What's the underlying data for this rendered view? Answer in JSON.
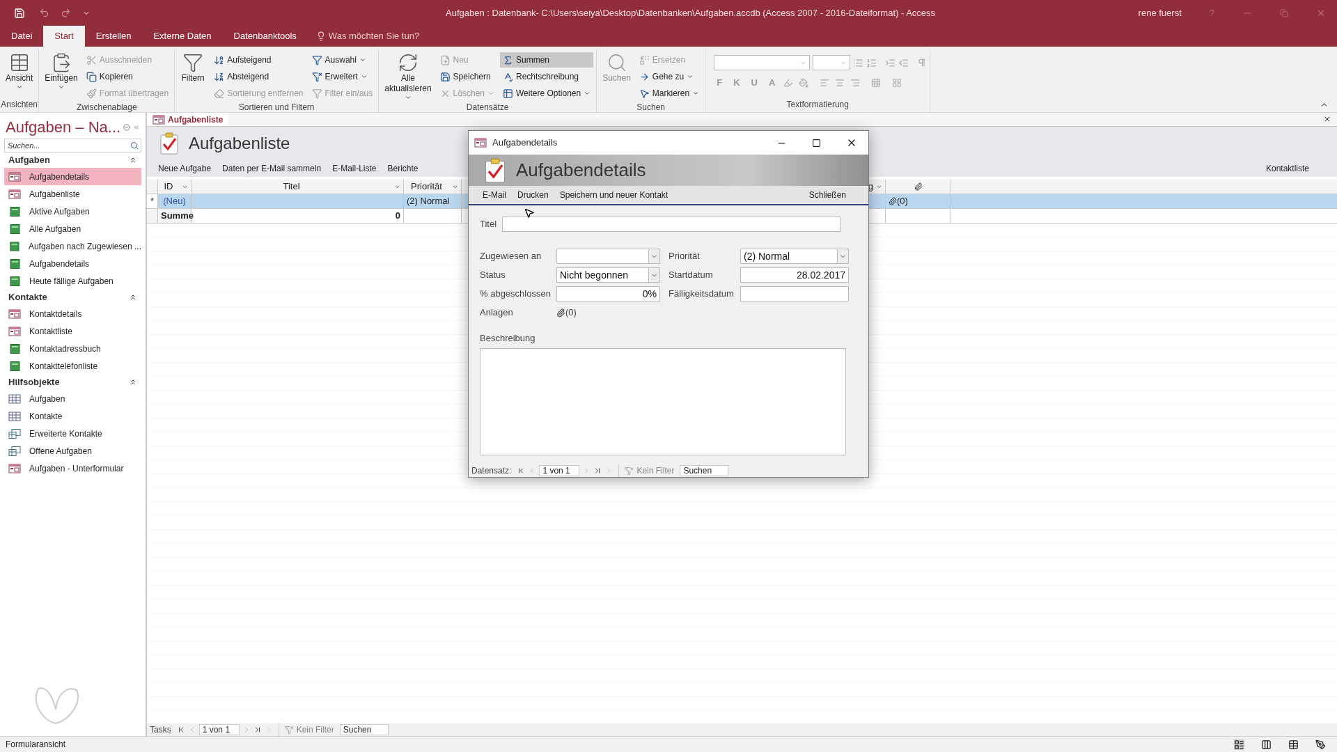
{
  "title_bar": {
    "title": "Aufgaben : Datenbank- C:\\Users\\seiya\\Desktop\\Datenbanken\\Aufgaben.accdb (Access 2007 - 2016-Dateiformat)  -  Access",
    "user": "rene fuerst",
    "help": "?"
  },
  "ribbon_tabs": [
    {
      "label": "Datei",
      "selected": false
    },
    {
      "label": "Start",
      "selected": true
    },
    {
      "label": "Erstellen",
      "selected": false
    },
    {
      "label": "Externe Daten",
      "selected": false
    },
    {
      "label": "Datenbanktools",
      "selected": false
    }
  ],
  "tell_me": "Was möchten Sie tun?",
  "ribbon_groups": [
    {
      "label": "Ansichten",
      "large": [
        {
          "label": "Ansicht",
          "dropdown": true,
          "disabled": false
        }
      ]
    },
    {
      "label": "Zwischenablage",
      "large": [
        {
          "label": "Einfügen",
          "dropdown": true,
          "disabled": false
        }
      ],
      "columns": [
        [
          {
            "label": "Ausschneiden",
            "disabled": true,
            "pressed": false,
            "dropdown": false
          },
          {
            "label": "Kopieren",
            "disabled": false,
            "pressed": false,
            "dropdown": false
          },
          {
            "label": "Format übertragen",
            "disabled": true,
            "pressed": false,
            "dropdown": false
          }
        ]
      ]
    },
    {
      "label": "Sortieren und Filtern",
      "large": [
        {
          "label": "Filtern",
          "dropdown": false,
          "disabled": false
        }
      ],
      "columns": [
        [
          {
            "label": "Aufsteigend",
            "disabled": false,
            "pressed": false,
            "dropdown": false
          },
          {
            "label": "Absteigend",
            "disabled": false,
            "pressed": false,
            "dropdown": false
          },
          {
            "label": "Sortierung entfernen",
            "disabled": true,
            "pressed": false,
            "dropdown": false
          }
        ],
        [
          {
            "label": "Auswahl",
            "disabled": false,
            "pressed": false,
            "dropdown": true
          },
          {
            "label": "Erweitert",
            "disabled": false,
            "pressed": false,
            "dropdown": true
          },
          {
            "label": "Filter ein/aus",
            "disabled": true,
            "pressed": false,
            "dropdown": false
          }
        ]
      ]
    },
    {
      "label": "Datensätze",
      "large": [
        {
          "label": "Alle aktualisieren",
          "dropdown": true,
          "disabled": false
        }
      ],
      "columns": [
        [
          {
            "label": "Neu",
            "disabled": true,
            "pressed": false,
            "dropdown": false
          },
          {
            "label": "Speichern",
            "disabled": false,
            "pressed": false,
            "dropdown": false
          },
          {
            "label": "Löschen",
            "disabled": true,
            "pressed": false,
            "dropdown": true
          }
        ],
        [
          {
            "label": "Summen",
            "disabled": false,
            "pressed": true,
            "dropdown": false
          },
          {
            "label": "Rechtschreibung",
            "disabled": false,
            "pressed": false,
            "dropdown": false
          },
          {
            "label": "Weitere Optionen",
            "disabled": false,
            "pressed": false,
            "dropdown": true
          }
        ]
      ]
    },
    {
      "label": "Suchen",
      "large": [
        {
          "label": "Suchen",
          "dropdown": false,
          "disabled": true
        }
      ],
      "columns": [
        [
          {
            "label": "Ersetzen",
            "disabled": true,
            "pressed": false,
            "dropdown": false
          },
          {
            "label": "Gehe zu",
            "disabled": false,
            "pressed": false,
            "dropdown": true
          },
          {
            "label": "Markieren",
            "disabled": false,
            "pressed": false,
            "dropdown": true
          }
        ]
      ]
    },
    {
      "label": "Textformatierung",
      "format_buttons": [
        {
          "label": "F",
          "disabled": true
        },
        {
          "label": "K",
          "disabled": true
        },
        {
          "label": "U",
          "disabled": true
        },
        {
          "label": "A",
          "disabled": true
        }
      ]
    }
  ],
  "nav_pane": {
    "title": "Aufgaben – Na...",
    "search_placeholder": "Suchen...",
    "groups": [
      {
        "label": "Aufgaben",
        "expanded": true,
        "items": [
          {
            "label": "Aufgabendetails",
            "kind": "form",
            "selected": true
          },
          {
            "label": "Aufgabenliste",
            "kind": "form",
            "selected": false
          },
          {
            "label": "Aktive Aufgaben",
            "kind": "report",
            "selected": false
          },
          {
            "label": "Alle Aufgaben",
            "kind": "report",
            "selected": false
          },
          {
            "label": "Aufgaben nach Zugewiesen ...",
            "kind": "report",
            "selected": false
          },
          {
            "label": "Aufgabendetails",
            "kind": "report",
            "selected": false
          },
          {
            "label": "Heute fällige Aufgaben",
            "kind": "report",
            "selected": false
          }
        ]
      },
      {
        "label": "Kontakte",
        "expanded": true,
        "items": [
          {
            "label": "Kontaktdetails",
            "kind": "form",
            "selected": false
          },
          {
            "label": "Kontaktliste",
            "kind": "form",
            "selected": false
          },
          {
            "label": "Kontaktadressbuch",
            "kind": "report",
            "selected": false
          },
          {
            "label": "Kontakttelefonliste",
            "kind": "report",
            "selected": false
          }
        ]
      },
      {
        "label": "Hilfsobjekte",
        "expanded": true,
        "items": [
          {
            "label": "Aufgaben",
            "kind": "table",
            "selected": false
          },
          {
            "label": "Kontakte",
            "kind": "table",
            "selected": false
          },
          {
            "label": "Erweiterte Kontakte",
            "kind": "query",
            "selected": false
          },
          {
            "label": "Offene Aufgaben",
            "kind": "query",
            "selected": false
          },
          {
            "label": "Aufgaben - Unterformular",
            "kind": "form",
            "selected": false
          }
        ]
      }
    ]
  },
  "document_tab": {
    "label": "Aufgabenliste"
  },
  "list_form": {
    "title": "Aufgabenliste",
    "commands": [
      "Neue Aufgabe",
      "Daten per E-Mail sammeln",
      "E-Mail-Liste",
      "Berichte"
    ],
    "right_command": "Kontaktliste",
    "columns": [
      {
        "label": "ID",
        "kind": "text"
      },
      {
        "label": "Titel",
        "kind": "text"
      },
      {
        "label": "Priorität",
        "kind": "text"
      },
      {
        "label": "g",
        "kind": "text"
      },
      {
        "kind": "attachment"
      }
    ],
    "new_row": {
      "marker": "*",
      "cells": [
        "(Neu)",
        "",
        "(2) Normal",
        "",
        "(0)"
      ]
    },
    "totals_row": {
      "cells": [
        "Summe",
        "0",
        "",
        "",
        ""
      ]
    },
    "record_nav": {
      "label": "Tasks",
      "position": "1 von 1",
      "filter": "Kein Filter",
      "search": "Suchen"
    }
  },
  "dialog": {
    "title": "Aufgabendetails",
    "header": "Aufgabendetails",
    "commands": [
      "E-Mail",
      "Drucken",
      "Speichern und neuer Kontakt"
    ],
    "close": "Schließen",
    "title_field": {
      "label": "Titel"
    },
    "left_fields": [
      {
        "label": "Zugewiesen an",
        "kind": "combo"
      },
      {
        "label": "Status",
        "kind": "combo",
        "value": "Nicht begonnen"
      },
      {
        "label": "% abgeschlossen",
        "kind": "number",
        "value": "0%"
      },
      {
        "label": "Anlagen",
        "kind": "attachment",
        "value": "(0)"
      }
    ],
    "right_fields": [
      {
        "label": "Priorität",
        "kind": "combo",
        "value": "(2) Normal"
      },
      {
        "label": "Startdatum",
        "kind": "number",
        "value": "28.02.2017"
      },
      {
        "label": "Fälligkeitsdatum",
        "kind": "number"
      }
    ],
    "description": {
      "label": "Beschreibung"
    },
    "record_nav": {
      "label": "Datensatz:",
      "position": "1 von 1",
      "filter": "Kein Filter",
      "search": "Suchen"
    }
  },
  "status_bar": {
    "text": "Formularansicht"
  }
}
